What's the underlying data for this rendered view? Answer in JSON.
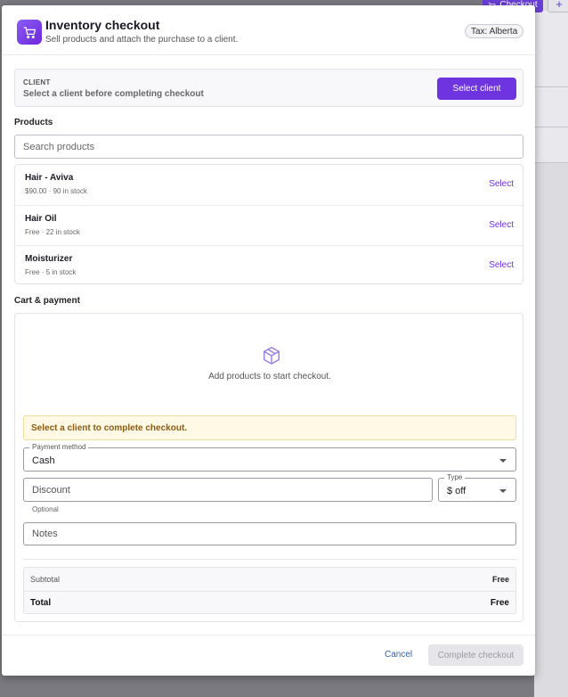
{
  "background": {
    "checkout_label": "Checkout",
    "plus_label": "+"
  },
  "header": {
    "title": "Inventory checkout",
    "subtitle": "Sell products and attach the purchase to a client.",
    "tax_badge": "Tax: Alberta"
  },
  "client": {
    "label": "CLIENT",
    "hint": "Select a client before completing checkout",
    "select_button": "Select client"
  },
  "products": {
    "title": "Products",
    "search_placeholder": "Search products",
    "items": [
      {
        "name": "Hair - Aviva",
        "price": "$90.00",
        "stock": "90 in stock",
        "action": "Select"
      },
      {
        "name": "Hair Oil",
        "price": "Free",
        "stock": "22 in stock",
        "action": "Select"
      },
      {
        "name": "Moisturizer",
        "price": "Free",
        "stock": "5 in stock",
        "action": "Select"
      }
    ],
    "meta_separator": "·"
  },
  "cart": {
    "title": "Cart & payment",
    "empty_text": "Add products to start checkout.",
    "warning": "Select a client to complete checkout.",
    "payment_method": {
      "legend": "Payment method",
      "value": "Cash"
    },
    "discount": {
      "placeholder": "Discount",
      "helper": "Optional"
    },
    "discount_type": {
      "legend": "Type",
      "value": "$ off"
    },
    "notes": {
      "placeholder": "Notes"
    },
    "summary": {
      "subtotal_label": "Subtotal",
      "subtotal_value": "Free",
      "total_label": "Total",
      "total_value": "Free"
    }
  },
  "footer": {
    "cancel": "Cancel",
    "complete": "Complete checkout"
  },
  "colors": {
    "accent": "#6d34e0",
    "warning_bg": "#fff9e6",
    "warning_text": "#8a5a10"
  },
  "icons": {
    "header": "shopping-cart-icon",
    "empty_cart": "package-icon"
  }
}
